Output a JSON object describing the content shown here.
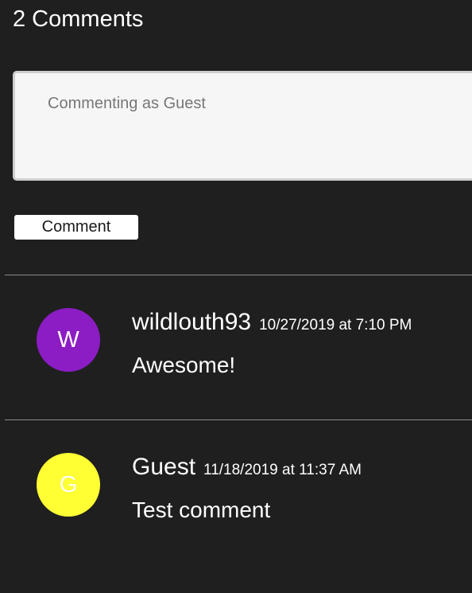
{
  "comments_section": {
    "title": "2 Comments",
    "input": {
      "placeholder": "Commenting as Guest",
      "value": ""
    },
    "submit_label": "Comment",
    "comments": [
      {
        "author": "wildlouth93",
        "date": "10/27/2019 at 7:10 PM",
        "text": "Awesome!",
        "avatar_letter": "W",
        "avatar_color": "#8c1cc4",
        "avatar_text_color": "#ffffff"
      },
      {
        "author": "Guest",
        "date": "11/18/2019 at 11:37 AM",
        "text": "Test comment",
        "avatar_letter": "G",
        "avatar_color": "#ffff33",
        "avatar_text_color": "#ffffff"
      }
    ]
  },
  "colors": {
    "background": "#1f1f1f",
    "divider": "#8a8a8a",
    "input_background": "#f6f6f6"
  }
}
